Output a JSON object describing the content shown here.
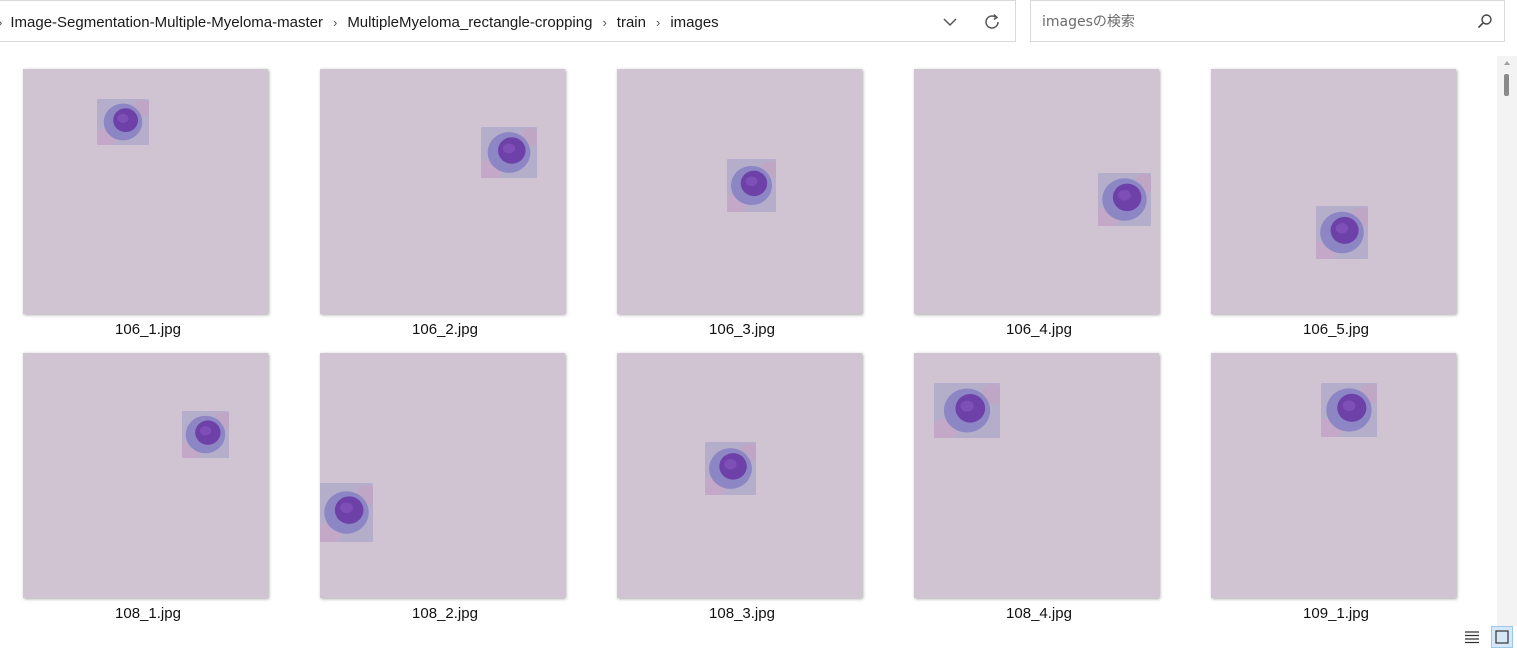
{
  "breadcrumb": {
    "items": [
      "Image-Segmentation-Multiple-Myeloma-master",
      "MultipleMyeloma_rectangle-cropping",
      "train",
      "images"
    ]
  },
  "address_bar": {
    "dropdown_icon": "chevron-down-icon",
    "refresh_icon": "refresh-icon"
  },
  "search": {
    "placeholder": "imagesの検索",
    "icon": "search-icon"
  },
  "colors": {
    "thumb_background": "#d0c4d3",
    "cell_background": "#b5aecb",
    "cell_body": "#8d86c5",
    "nucleus": "#6e41a8"
  },
  "files": [
    {
      "name": "106_1.jpg"
    },
    {
      "name": "106_2.jpg"
    },
    {
      "name": "106_3.jpg"
    },
    {
      "name": "106_4.jpg"
    },
    {
      "name": "106_5.jpg"
    },
    {
      "name": "108_1.jpg"
    },
    {
      "name": "108_2.jpg"
    },
    {
      "name": "108_3.jpg"
    },
    {
      "name": "108_4.jpg"
    },
    {
      "name": "109_1.jpg"
    }
  ],
  "view_buttons": [
    {
      "icon": "details-view-icon",
      "active": false
    },
    {
      "icon": "large-icons-view-icon",
      "active": true
    }
  ]
}
